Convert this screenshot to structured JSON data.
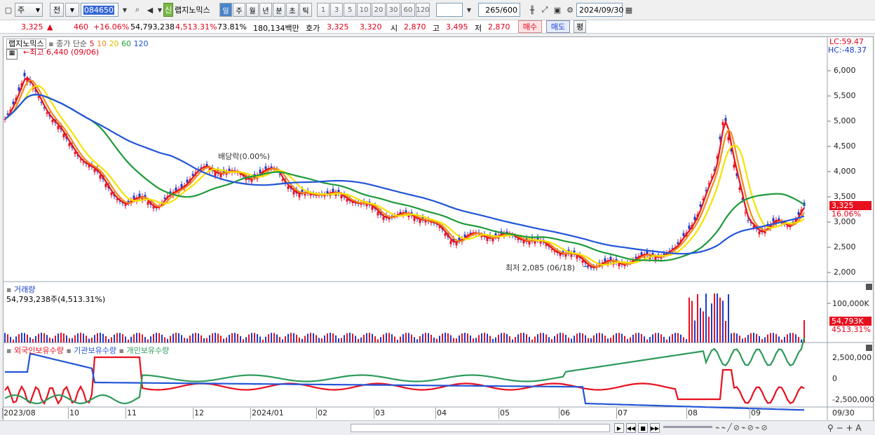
{
  "toolbar": {
    "period_type": "주",
    "market": "전",
    "stock_code": "084650",
    "credit_badge": "신",
    "stock_name": "랩지노믹스",
    "periods": [
      "일",
      "주",
      "월",
      "년",
      "분",
      "초",
      "틱"
    ],
    "selected_period": "일",
    "intervals": [
      "1",
      "3",
      "5",
      "10",
      "20",
      "30",
      "60",
      "120"
    ],
    "count_value": "265",
    "count_total": "/600",
    "date": "2024/09/30"
  },
  "quote": {
    "price": "3,325",
    "change_arrow": "▲",
    "change": "460",
    "change_pct": "+16.06%",
    "volume": "54,793,238",
    "volume_pct": "4,513.31%",
    "turnover_ratio": "73.81%",
    "trade_value": "180,134백만",
    "bid_label": "호가",
    "ask": "3,325",
    "bid": "3,320",
    "open_label": "시",
    "open": "2,870",
    "high_label": "고",
    "high": "3,495",
    "low_label": "저",
    "low": "2,870",
    "buy_label": "매수",
    "sell_label": "매도",
    "eval_label": "평"
  },
  "price_panel": {
    "stock_name": "랩지노믹스",
    "ma_title": "종가 단순",
    "ma_periods": [
      "5",
      "10",
      "20",
      "60",
      "120"
    ],
    "ma_colors": [
      "#e8101e",
      "#f08a1e",
      "#f4e300",
      "#1e9a3a",
      "#2255d8"
    ],
    "max_label": "←최고 6,440 (09/06)",
    "min_label": "최저 2,085 (06/18)",
    "dividend_label": "배당락(0.00%)",
    "lc": "LC:59.47",
    "hc": "HC:-48.37",
    "y_ticks": [
      "6,000",
      "5,500",
      "5,000",
      "4,500",
      "4,000",
      "3,500",
      "3,000",
      "2,500",
      "2,000"
    ],
    "current_price_tag": "3,325",
    "current_pct_tag": "16.06%"
  },
  "volume_panel": {
    "title": "거래량",
    "value_label": "54,793,238주(4,513.31%)",
    "y_tick": "100,000K",
    "current_tag": "54,793K",
    "current_pct_tag": "4513.31%"
  },
  "holding_panel": {
    "series": [
      "외국인보유수량",
      "기관보유수량",
      "개인보유수량"
    ],
    "series_colors": [
      "#e8101e",
      "#2255d8",
      "#2e9a5a"
    ],
    "y_ticks": [
      "2,500,000",
      "0",
      "-2,500,000"
    ]
  },
  "x_axis": {
    "labels": [
      "2023/08",
      "10",
      "11",
      "12",
      "2024/01",
      "02",
      "03",
      "04",
      "05",
      "06",
      "07",
      "08",
      "09",
      "09/30"
    ]
  }
}
